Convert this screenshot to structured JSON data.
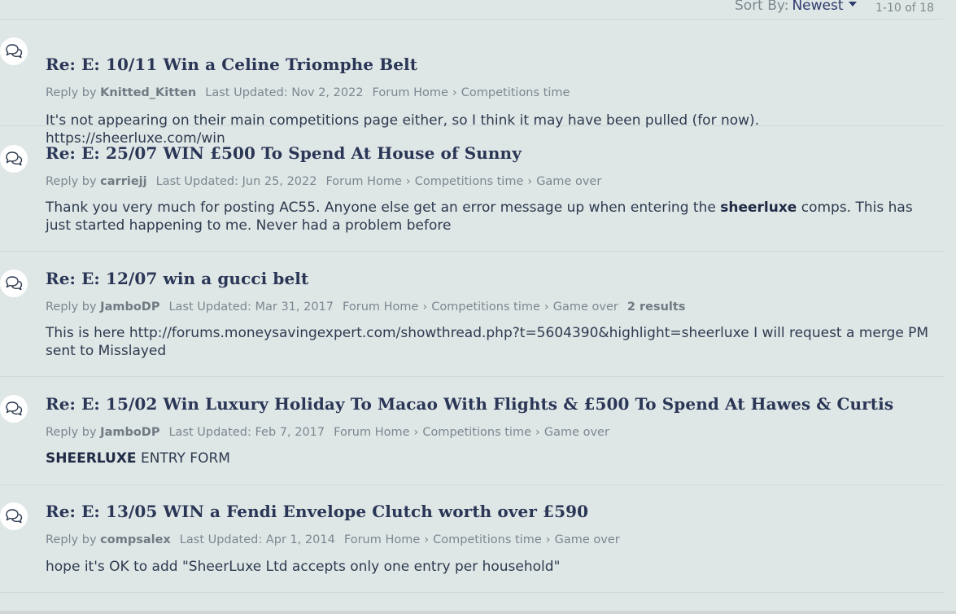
{
  "toolbar": {
    "sort_label": "Sort By:",
    "sort_value": "Newest",
    "count": "1-10 of 18"
  },
  "posts": [
    {
      "title": "Re: E: 10/11 Win a Celine Triomphe Belt",
      "reply_by": "Reply by",
      "author": "Knitted_Kitten",
      "last_updated": "Last Updated: Nov 2, 2022",
      "crumbs": [
        "Forum Home",
        "Competitions time"
      ],
      "results": "",
      "snippet_pre": "It's not appearing on their main competitions page either, so I think it may have been pulled (for now). https://sheerluxe.com/win",
      "snippet_hl": "",
      "snippet_post": ""
    },
    {
      "title": "Re: E: 25/07 WIN £500 To Spend At House of Sunny",
      "reply_by": "Reply by",
      "author": "carriejj",
      "last_updated": "Last Updated: Jun 25, 2022",
      "crumbs": [
        "Forum Home",
        "Competitions time",
        "Game over"
      ],
      "results": "",
      "snippet_pre": "Thank you very much for posting AC55. Anyone else get an error message up when entering the ",
      "snippet_hl": "sheerluxe",
      "snippet_post": " comps. This has just started happening to me. Never had a problem before"
    },
    {
      "title": "Re: E: 12/07 win a gucci belt",
      "reply_by": "Reply by",
      "author": "JamboDP",
      "last_updated": "Last Updated: Mar 31, 2017",
      "crumbs": [
        "Forum Home",
        "Competitions time",
        "Game over"
      ],
      "results": "2 results",
      "snippet_pre": "This is here http://forums.moneysavingexpert.com/showthread.php?t=5604390&highlight=sheerluxe I will request a merge PM sent to Misslayed",
      "snippet_hl": "",
      "snippet_post": ""
    },
    {
      "title": "Re: E: 15/02 Win Luxury Holiday To Macao With Flights & £500 To Spend At Hawes & Curtis",
      "reply_by": "Reply by",
      "author": "JamboDP",
      "last_updated": "Last Updated: Feb 7, 2017",
      "crumbs": [
        "Forum Home",
        "Competitions time",
        "Game over"
      ],
      "results": "",
      "snippet_pre": "",
      "snippet_hl": "SHEERLUXE",
      "snippet_post": " ENTRY FORM"
    },
    {
      "title": "Re: E: 13/05 WIN a Fendi Envelope Clutch worth over £590",
      "reply_by": "Reply by",
      "author": "compsalex",
      "last_updated": "Last Updated: Apr 1, 2014",
      "crumbs": [
        "Forum Home",
        "Competitions time",
        "Game over"
      ],
      "results": "",
      "snippet_pre": "hope it's OK to add \"SheerLuxe Ltd accepts only one entry per household\"",
      "snippet_hl": "",
      "snippet_post": ""
    }
  ]
}
